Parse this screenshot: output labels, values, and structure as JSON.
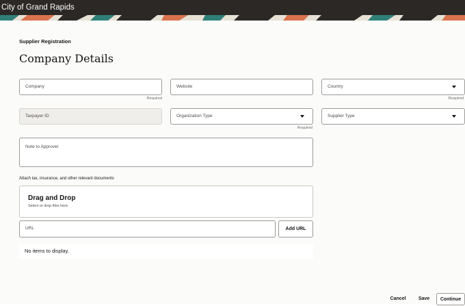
{
  "header": {
    "title": "City of Grand Rapids"
  },
  "page": {
    "kicker": "Supplier Registration",
    "title": "Company Details"
  },
  "fields": {
    "company": {
      "label": "Company",
      "required": "Required"
    },
    "website": {
      "label": "Website"
    },
    "country": {
      "label": "Country",
      "required": "Required"
    },
    "taxpayer_id": {
      "label": "Taxpayer ID"
    },
    "organization_type": {
      "label": "Organization Type",
      "required": "Required"
    },
    "supplier_type": {
      "label": "Supplier Type"
    },
    "note_to_approver": {
      "label": "Note to Approver"
    }
  },
  "attachments": {
    "label": "Attach tax, insurance, and other relevant documents",
    "dropzone_title": "Drag and Drop",
    "dropzone_subtitle": "Select or drop files here.",
    "url_placeholder": "URL",
    "add_url_label": "Add URL",
    "empty_text": "No items to display."
  },
  "footer": {
    "cancel_label": "Cancel",
    "save_label": "Save",
    "continue_label": "Continue"
  },
  "colors": {
    "topbar": "#2b2826",
    "banner_accent_teal": "#2f7f78",
    "banner_accent_coral": "#d9734e",
    "disabled_field": "#f0eeeb"
  },
  "icons": {
    "select_chevron": "chevron-down-icon"
  }
}
